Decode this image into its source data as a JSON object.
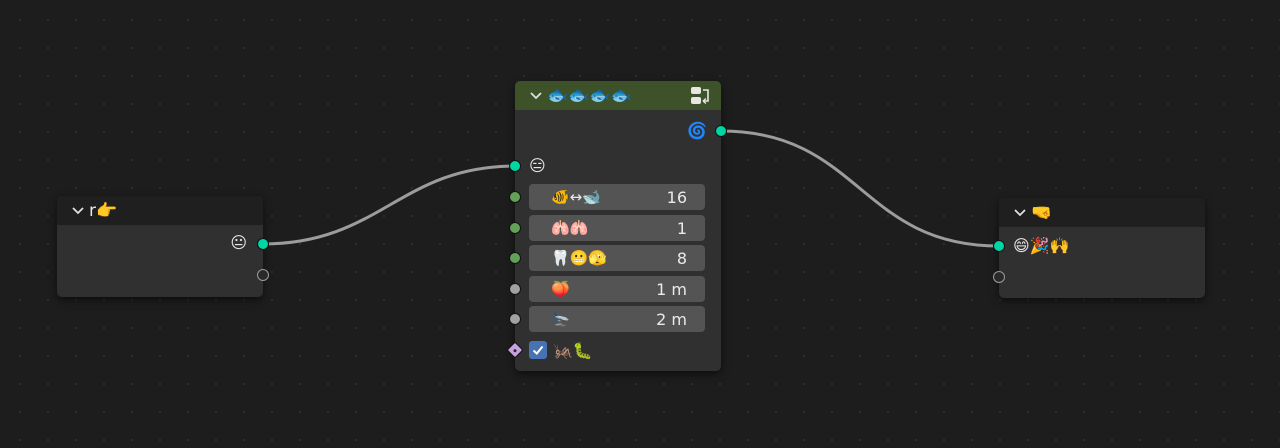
{
  "colors": {
    "canvas_bg": "#1d1d1d",
    "node_bg": "#303030",
    "header_default": "#1f1f1f",
    "header_group": "#3d5228",
    "socket_teal": "#00d6a3",
    "socket_green": "#63a158",
    "socket_gray": "#a1a1a1",
    "socket_diamond": "#c8a2de",
    "field_bg": "#545454",
    "checkbox_blue": "#4772b3",
    "link": "#9c9c9c"
  },
  "left_node": {
    "title": "r👉",
    "output_label": "😐"
  },
  "group_node": {
    "title": "🐟🐟🐟🐟",
    "header_icon": "node-tree-icon",
    "output_label": "🌀",
    "input_label": "😑",
    "fields": [
      {
        "label": "🐠↔🐋",
        "value": "16",
        "socket": "green"
      },
      {
        "label": "🫁🫁",
        "value": "1",
        "socket": "green"
      },
      {
        "label": "🦷😬🫣",
        "value": "8",
        "socket": "green"
      },
      {
        "label": "🍑",
        "value": "1 m",
        "socket": "gray"
      },
      {
        "label": "🛬",
        "value": "2 m",
        "socket": "gray"
      }
    ],
    "checkbox": {
      "checked": true,
      "label": "🦗🐛"
    }
  },
  "right_node": {
    "title": "🤜",
    "input_label": "😄🎉🙌"
  }
}
